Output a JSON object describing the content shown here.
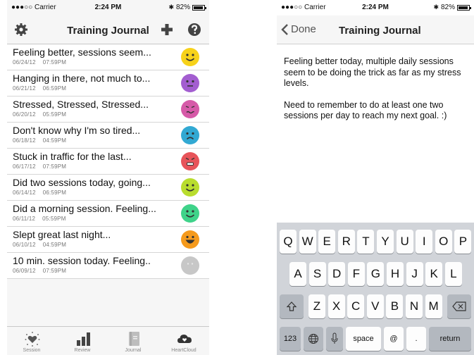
{
  "left": {
    "status": {
      "carrier": "●●●○○ Carrier",
      "time": "2:24 PM",
      "battery": "82%"
    },
    "nav": {
      "title": "Training Journal"
    },
    "entries": [
      {
        "text": "Feeling better, sessions seem...",
        "date": "06/24/12",
        "time": "07:59PM",
        "mood": "happy",
        "color": "#f7d21a"
      },
      {
        "text": "Hanging in there, not much to...",
        "date": "06/21/12",
        "time": "06:59PM",
        "mood": "neutral",
        "color": "#a35ed0"
      },
      {
        "text": "Stressed, Stressed, Stressed...",
        "date": "06/20/12",
        "time": "05:59PM",
        "mood": "stressed",
        "color": "#d65aa8"
      },
      {
        "text": "Don't know why I'm so tired...",
        "date": "06/18/12",
        "time": "04:59PM",
        "mood": "sad",
        "color": "#32a9d3"
      },
      {
        "text": "Stuck in traffic for the last...",
        "date": "06/17/12",
        "time": "07:59PM",
        "mood": "angry",
        "color": "#e7545a"
      },
      {
        "text": "Did two sessions today, going...",
        "date": "06/14/12",
        "time": "06:59PM",
        "mood": "happy",
        "color": "#b9dd2e"
      },
      {
        "text": "Did a morning session. Feeling...",
        "date": "06/11/12",
        "time": "05:59PM",
        "mood": "happy",
        "color": "#3fd38a"
      },
      {
        "text": "Slept great last night...",
        "date": "06/10/12",
        "time": "04:59PM",
        "mood": "grin",
        "color": "#f59a1c"
      },
      {
        "text": "10 min. session today. Feeling..",
        "date": "06/09/12",
        "time": "07:59PM",
        "mood": "blank",
        "color": "#c7c7c7"
      }
    ],
    "tabs": [
      "Session",
      "Review",
      "Journal",
      "HeartCloud"
    ]
  },
  "right": {
    "status": {
      "carrier": "●●●○○ Carrier",
      "time": "2:24 PM",
      "battery": "82%"
    },
    "nav": {
      "back": "Done",
      "title": "Training Journal"
    },
    "note": [
      "Feeling better today, multiple daily sessions seem to be doing the trick as far as my stress levels.",
      "Need to remember to do at least one two sessions per day to reach my next goal. :)"
    ],
    "keyboard": {
      "row1": [
        "Q",
        "W",
        "E",
        "R",
        "T",
        "Y",
        "U",
        "I",
        "O",
        "P"
      ],
      "row2": [
        "A",
        "S",
        "D",
        "F",
        "G",
        "H",
        "J",
        "K",
        "L"
      ],
      "row3": [
        "Z",
        "X",
        "C",
        "V",
        "B",
        "N",
        "M"
      ],
      "num": "123",
      "space": "space",
      "at": "@",
      "dot": ".",
      "return": "return"
    }
  }
}
